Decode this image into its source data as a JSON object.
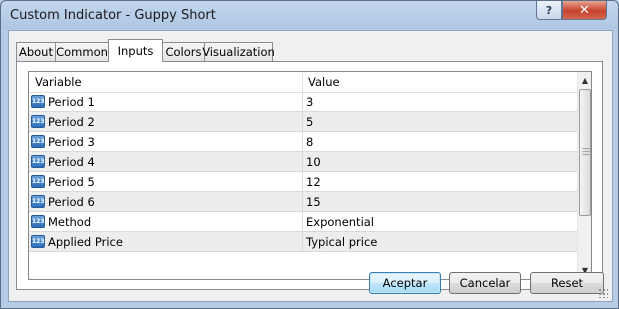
{
  "window": {
    "title": "Custom Indicator - Guppy Short",
    "help_label": "?",
    "close_label": "✕"
  },
  "tabs": [
    {
      "label": "About"
    },
    {
      "label": "Common"
    },
    {
      "label": "Inputs",
      "active": true
    },
    {
      "label": "Colors"
    },
    {
      "label": "Visualization"
    }
  ],
  "grid": {
    "columns": {
      "variable": "Variable",
      "value": "Value"
    },
    "type_icon_text": "123",
    "rows": [
      {
        "name": "Period 1",
        "value": "3"
      },
      {
        "name": "Period 2",
        "value": "5"
      },
      {
        "name": "Period 3",
        "value": "8"
      },
      {
        "name": "Period 4",
        "value": "10"
      },
      {
        "name": "Period 5",
        "value": "12"
      },
      {
        "name": "Period 6",
        "value": "15"
      },
      {
        "name": "Method",
        "value": "Exponential"
      },
      {
        "name": "Applied Price",
        "value": "Typical price"
      }
    ]
  },
  "buttons": {
    "accept": "Aceptar",
    "cancel": "Cancelar",
    "reset": "Reset"
  }
}
